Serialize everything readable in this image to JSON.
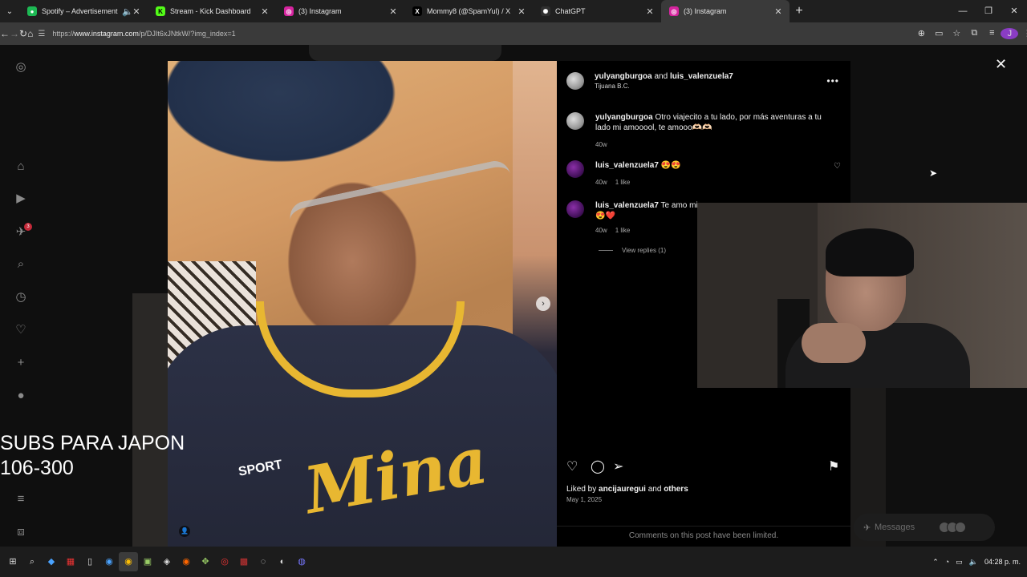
{
  "browser": {
    "tabs": [
      {
        "title": "Spotify – Advertisement",
        "favicon_color": "#1db954",
        "favicon": "●",
        "audio": true
      },
      {
        "title": "Stream - Kick Dashboard",
        "favicon_color": "#1f1f1f",
        "favicon": "K"
      },
      {
        "title": "(3) Instagram",
        "favicon_color": "#d6249f",
        "favicon": "◎"
      },
      {
        "title": "Mommy8 (@SpamYul) / X",
        "favicon_color": "#1f1f1f",
        "favicon": "𝕏"
      },
      {
        "title": "ChatGPT",
        "favicon_color": "#1f1f1f",
        "favicon": "✺"
      },
      {
        "title": "(3) Instagram",
        "favicon_color": "#d6249f",
        "favicon": "◎",
        "active": true
      }
    ],
    "url_prefix": "https://",
    "url_domain": "www.instagram.com",
    "url_path": "/p/DJIt6xJNtkW/?img_index=1",
    "profile_initial": "J"
  },
  "post": {
    "author": "yulyangburgoa",
    "and": "and",
    "coauthor": "luis_valenzuela7",
    "location": "Tijuana B.C.",
    "more": "•••",
    "comments": [
      {
        "user": "yulyangburgoa",
        "text": "Otro viajecito a tu lado, por más aventuras a tu lado mi amooool, te amooo🫶🏻🫶🏻",
        "age": "40w",
        "likes": ""
      },
      {
        "user": "luis_valenzuela7",
        "text": "😍😍",
        "age": "40w",
        "likes": "1 like"
      },
      {
        "user": "luis_valenzuela7",
        "text": "Te amo mi",
        "text2": "😍❤️",
        "age": "40w",
        "likes": "1 like"
      }
    ],
    "view_replies": "View replies (1)",
    "liked_prefix": "Liked by",
    "liked_user": "ancijauregui",
    "liked_and": "and",
    "liked_others": "others",
    "date": "May 1, 2025",
    "limited": "Comments on this post have been limited.",
    "photo_text": "Mina",
    "photo_jersey_sub": "SPORT"
  },
  "messages": {
    "label": "Messages",
    "badge": "2"
  },
  "overlay": {
    "line1": "SUBS PARA JAPON",
    "line2": "106-300"
  },
  "notifications_badge": "3",
  "taskbar": {
    "time": "04:28 p. m."
  }
}
